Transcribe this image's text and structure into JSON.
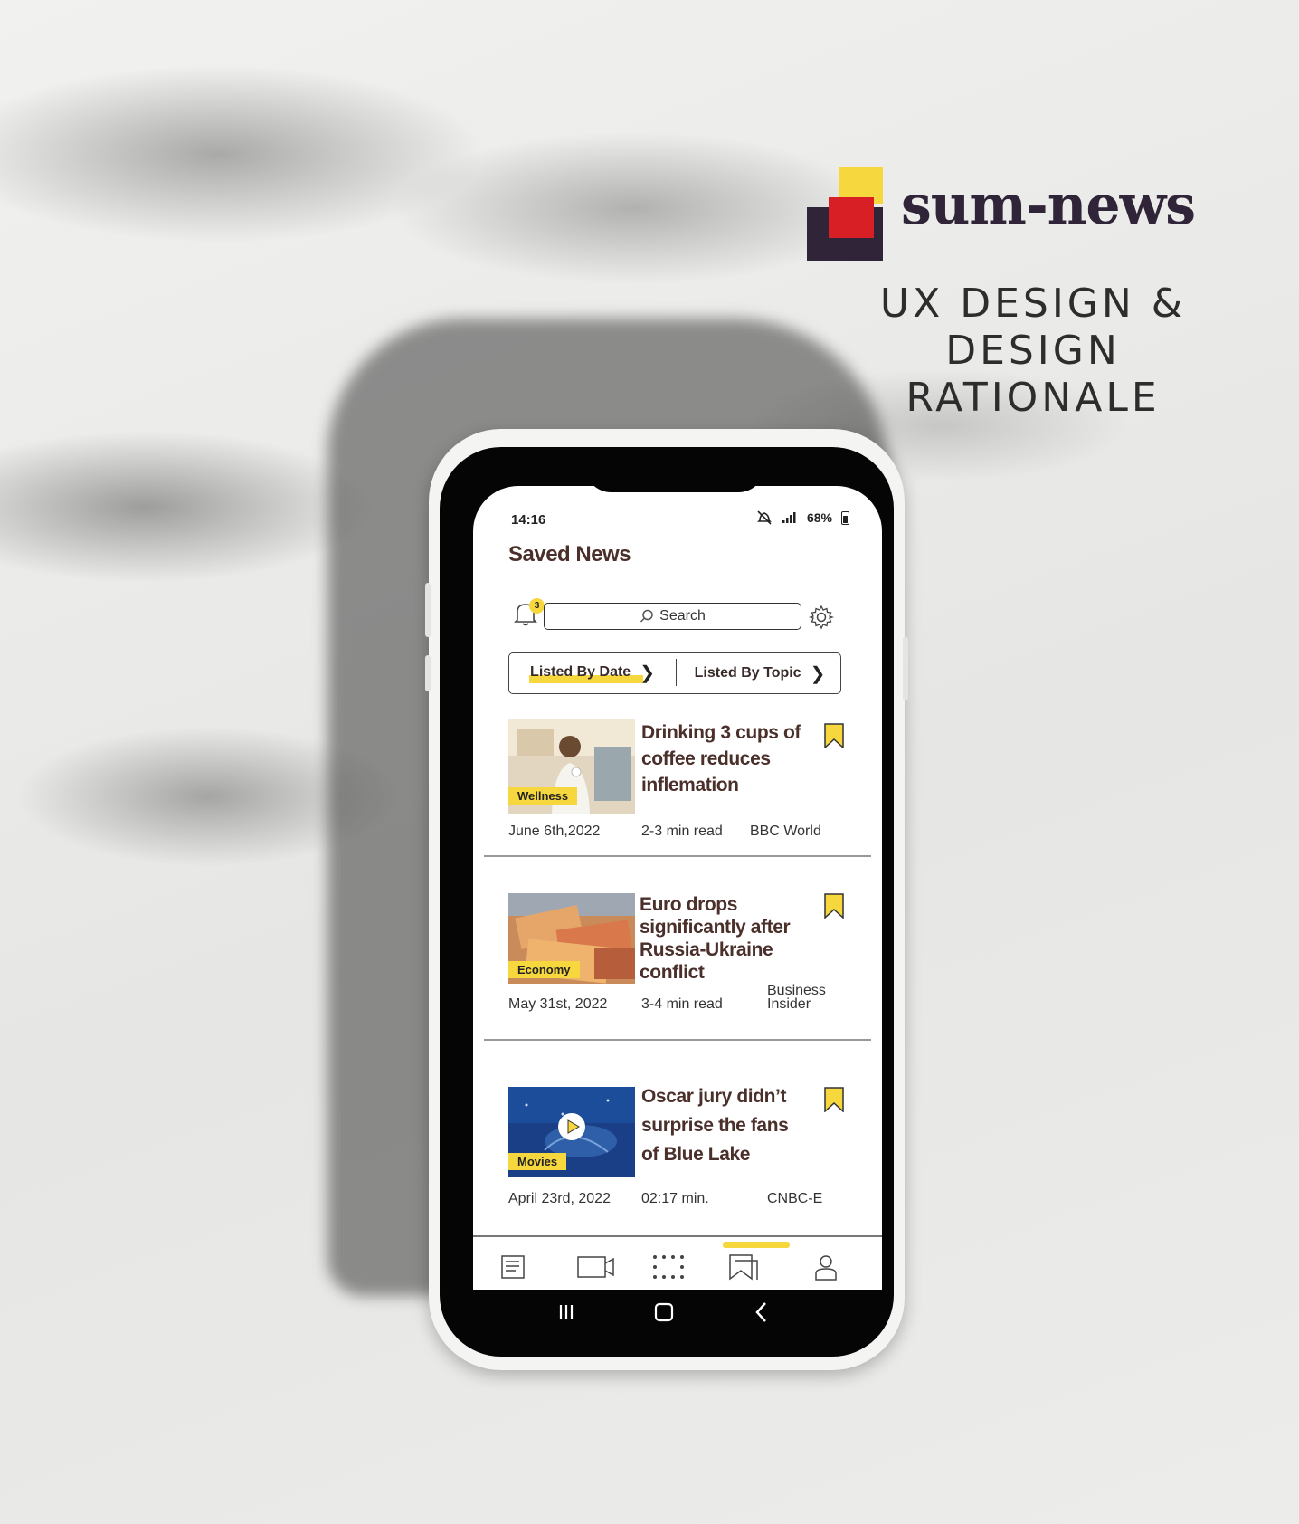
{
  "brand": {
    "name": "sum-news",
    "tagline": "UX DESIGN & DESIGN\nRATIONALE",
    "colors": {
      "yellow": "#f7d73e",
      "red": "#d81f26",
      "navy": "#2f2438"
    }
  },
  "status_bar": {
    "time": "14:16",
    "battery": "68%"
  },
  "screen": {
    "title": "Saved News",
    "notification_count": "3",
    "search": {
      "placeholder": "Search"
    },
    "filter": {
      "by_date": "Listed By Date",
      "by_topic": "Listed By Topic",
      "active": "by_date"
    }
  },
  "articles": [
    {
      "category": "Wellness",
      "headline": "Drinking 3 cups of coffee reduces inflemation",
      "date": "June 6th,2022",
      "duration": "2-3 min read",
      "source": "BBC World"
    },
    {
      "category": "Economy",
      "headline": "Euro drops significantly after Russia-Ukraine conflict",
      "date": "May 31st, 2022",
      "duration": "3-4 min read",
      "source": "Business Insider"
    },
    {
      "category": "Movies",
      "headline": "Oscar jury didn’t surprise the fans of Blue Lake",
      "date": "April 23rd, 2022",
      "duration": "02:17 min.",
      "source": "CNBC-E"
    }
  ],
  "bottom_nav": {
    "items": [
      "news-feed-icon",
      "video-icon",
      "apps-grid-icon",
      "bookmarks-icon",
      "profile-icon"
    ],
    "active": "bookmarks-icon"
  }
}
